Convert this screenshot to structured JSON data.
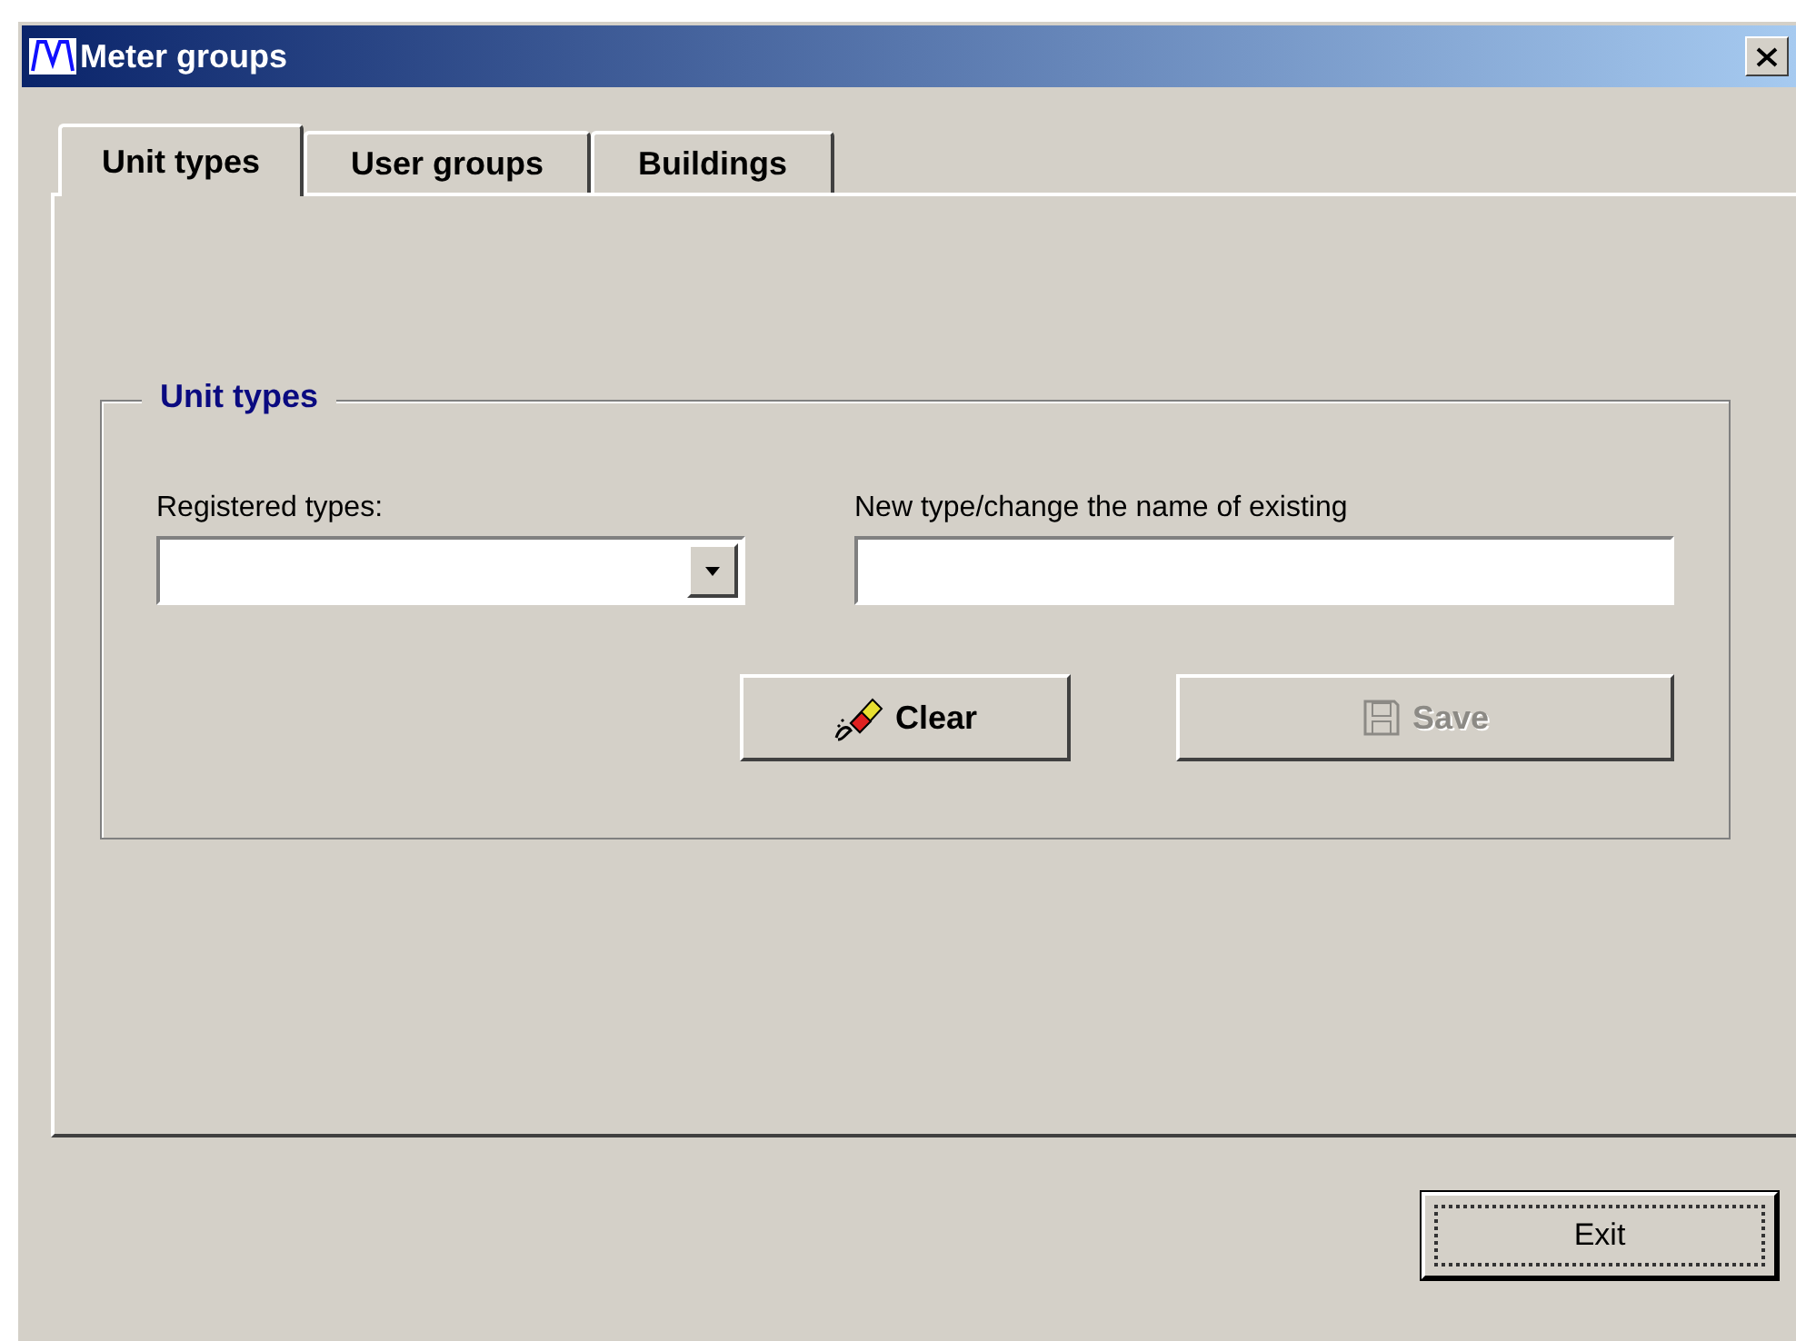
{
  "window": {
    "title": "Meter groups"
  },
  "tabs": [
    {
      "label": "Unit types",
      "selected": true
    },
    {
      "label": "User groups",
      "selected": false
    },
    {
      "label": "Buildings",
      "selected": false
    }
  ],
  "group": {
    "title": "Unit types",
    "registered_types": {
      "label": "Registered types:"
    },
    "new_type": {
      "label": "New type/change the name of existing"
    },
    "buttons": [
      {
        "kind": "clear",
        "label": "Clear",
        "disabled": false
      },
      {
        "kind": "save",
        "label": "Save",
        "disabled": true
      }
    ]
  },
  "exit_button": {
    "label": "Exit",
    "focused": true
  }
}
